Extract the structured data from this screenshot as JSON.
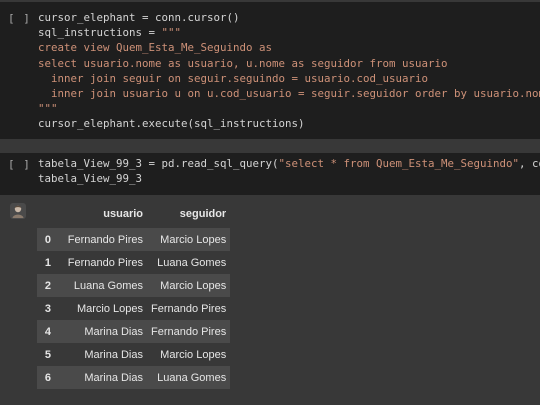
{
  "cells": [
    {
      "run_label": "[ ]",
      "lines": [
        [
          {
            "t": "cursor_elephant = conn.cursor()",
            "c": "plain"
          }
        ],
        [
          {
            "t": "sql_instructions = ",
            "c": "plain"
          },
          {
            "t": "\"\"\"",
            "c": "str"
          }
        ],
        [
          {
            "t": "create view Quem_Esta_Me_Seguindo as",
            "c": "str"
          }
        ],
        [
          {
            "t": "select usuario.nome as usuario, u.nome as seguidor from usuario",
            "c": "str"
          }
        ],
        [
          {
            "t": "  inner join seguir on seguir.seguindo = usuario.cod_usuario",
            "c": "str"
          }
        ],
        [
          {
            "t": "  inner join usuario u on u.cod_usuario = seguir.seguidor order by usuario.nome;",
            "c": "str"
          }
        ],
        [
          {
            "t": "\"\"\"",
            "c": "str"
          }
        ],
        [
          {
            "t": "cursor_elephant.execute(sql_instructions)",
            "c": "plain"
          }
        ]
      ]
    },
    {
      "run_label": "[ ]",
      "lines": [
        [
          {
            "t": "tabela_View_99_3 = pd.read_sql_query(",
            "c": "plain"
          },
          {
            "t": "\"select * from Quem_Esta_Me_Seguindo\"",
            "c": "str"
          },
          {
            "t": ", conn)",
            "c": "plain"
          }
        ],
        [
          {
            "t": "tabela_View_99_3",
            "c": "plain"
          }
        ]
      ]
    }
  ],
  "output": {
    "icon": "output-avatar-icon",
    "columns": [
      "",
      "usuario",
      "seguidor"
    ],
    "rows": [
      [
        "0",
        "Fernando Pires",
        "Marcio Lopes"
      ],
      [
        "1",
        "Fernando Pires",
        "Luana Gomes"
      ],
      [
        "2",
        "Luana Gomes",
        "Marcio Lopes"
      ],
      [
        "3",
        "Marcio Lopes",
        "Fernando Pires"
      ],
      [
        "4",
        "Marina Dias",
        "Fernando Pires"
      ],
      [
        "5",
        "Marina Dias",
        "Marcio Lopes"
      ],
      [
        "6",
        "Marina Dias",
        "Luana Gomes"
      ]
    ]
  },
  "colors": {
    "cell_bg": "#1e1e1e",
    "page_bg": "#383838",
    "code_plain": "#d4d4d4",
    "code_string": "#ce9178",
    "row_stripe": "#4a4a4a"
  }
}
